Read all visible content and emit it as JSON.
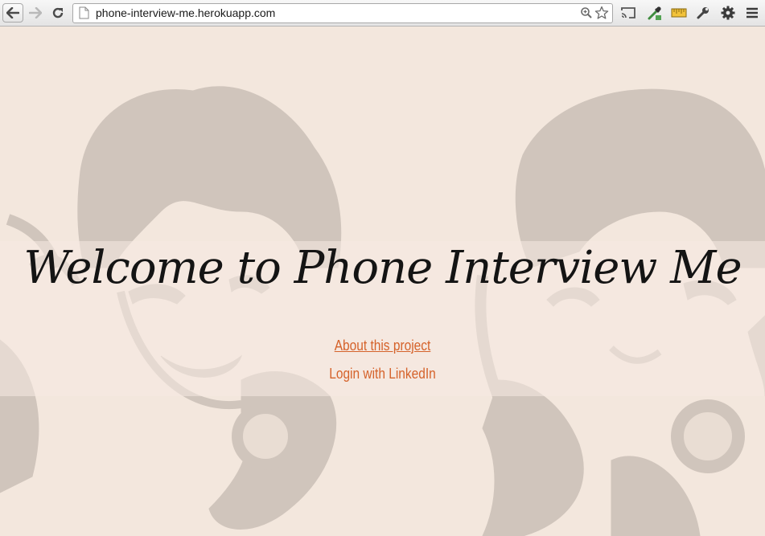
{
  "browser": {
    "url": "phone-interview-me.herokuapp.com",
    "icons": {
      "back": "back-arrow-icon",
      "forward": "forward-arrow-icon",
      "reload": "reload-icon",
      "page": "page-icon",
      "zoom": "zoom-icon",
      "bookmark": "star-icon",
      "cast": "cast-icon",
      "eyedropper": "eyedropper-icon",
      "ruler": "ruler-icon",
      "wrench": "wrench-icon",
      "settings": "gear-icon",
      "menu": "menu-icon"
    }
  },
  "page": {
    "title": "Welcome to Phone Interview Me",
    "links": {
      "about": "About this project",
      "login": "Login with LinkedIn"
    },
    "colors": {
      "background": "#f3e7dd",
      "illustration": "#d0c5bc",
      "link": "#d5622a",
      "title": "#141414"
    }
  }
}
